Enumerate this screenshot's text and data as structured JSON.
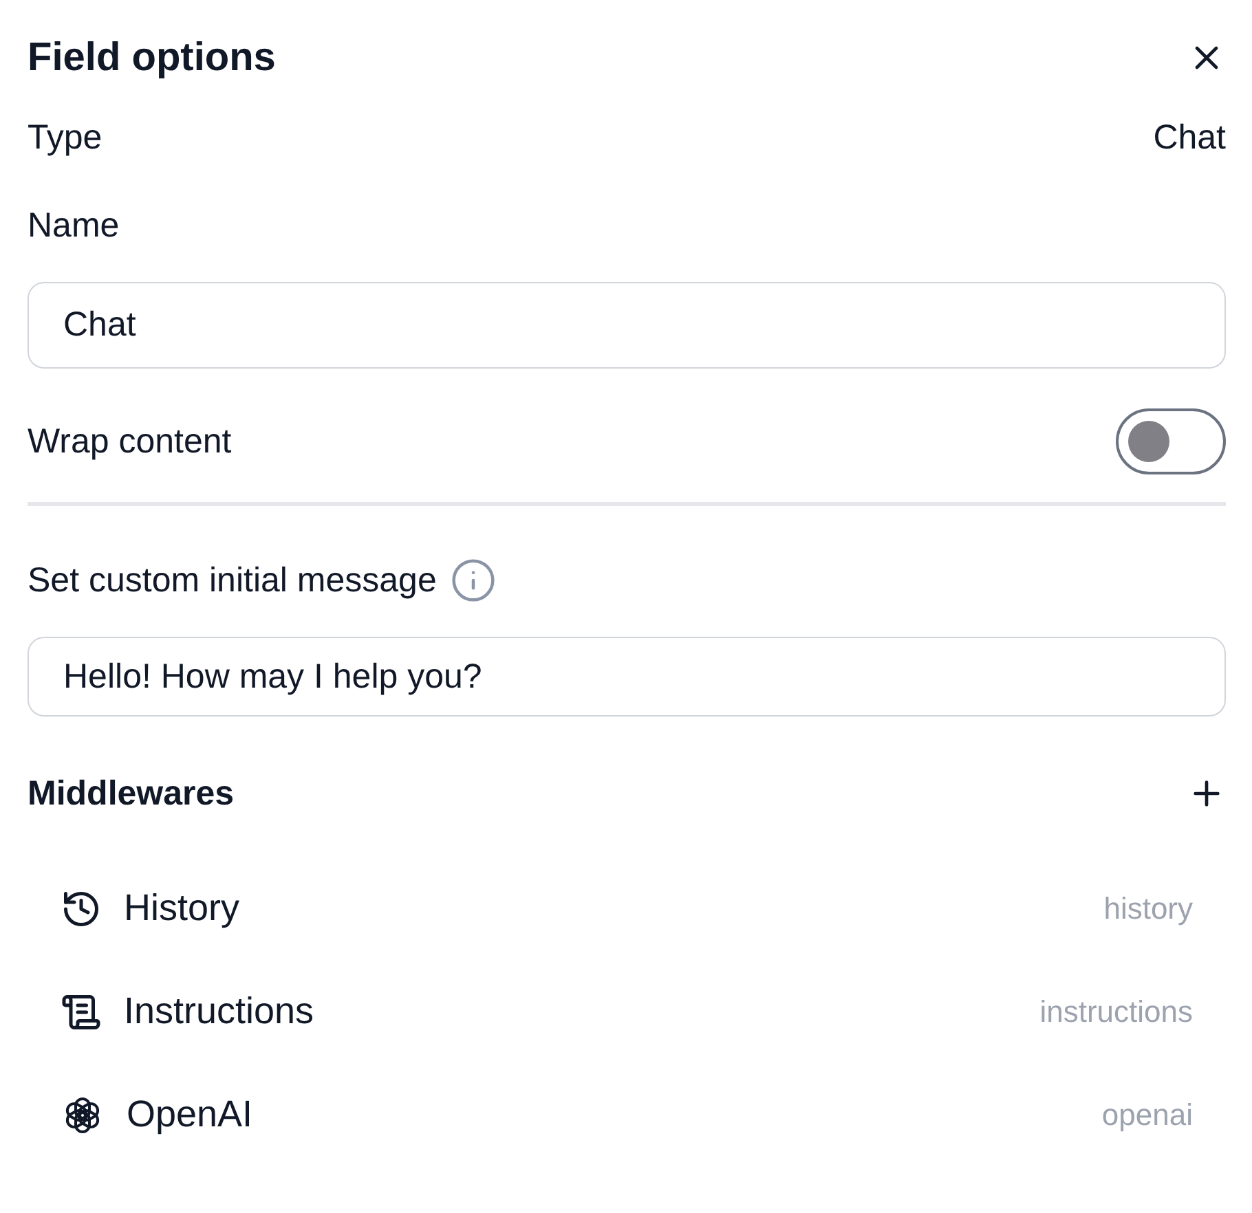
{
  "header": {
    "title": "Field options"
  },
  "type": {
    "label": "Type",
    "value": "Chat"
  },
  "name": {
    "label": "Name",
    "value": "Chat"
  },
  "wrap": {
    "label": "Wrap content",
    "on": false
  },
  "initial_message": {
    "label": "Set custom initial message",
    "value": "Hello! How may I help you?"
  },
  "middlewares": {
    "title": "Middlewares",
    "items": [
      {
        "kind": "history",
        "label": "History",
        "slug": "history"
      },
      {
        "kind": "instructions",
        "label": "Instructions",
        "slug": "instructions"
      },
      {
        "kind": "openai",
        "label": "OpenAI",
        "slug": "openai"
      }
    ]
  }
}
